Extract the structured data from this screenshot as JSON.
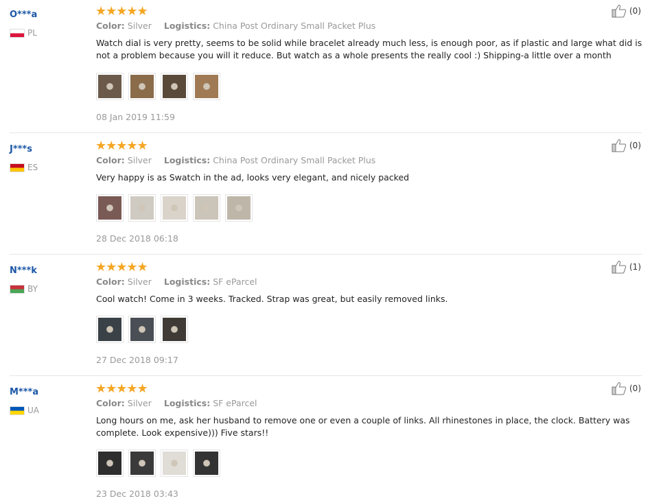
{
  "reviews": [
    {
      "user": "O***a",
      "country": "PL",
      "flag": [
        "#ffffff",
        "#dc143c"
      ],
      "rating": 5,
      "stars": "★★★★★",
      "color_label": "Color:",
      "color_value": "Silver",
      "logistics_label": "Logistics:",
      "logistics_value": "China Post Ordinary Small Packet Plus",
      "text": "Watch dial is very pretty, seems to be solid while bracelet already much less, is enough poor, as if plastic and large what did is not a problem because you will it reduce. But watch as a whole presents the really cool :) Shipping-a little over a month",
      "likes": "(0)",
      "date": "08 Jan 2019 11:59",
      "photos": [
        "#6b5a4a",
        "#8a6b4a",
        "#5a4a3a",
        "#a07a55"
      ]
    },
    {
      "user": "J***s",
      "country": "ES",
      "flag": [
        "#c60b1e",
        "#ffc400"
      ],
      "rating": 5,
      "stars": "★★★★★",
      "color_label": "Color:",
      "color_value": "Silver",
      "logistics_label": "Logistics:",
      "logistics_value": "China Post Ordinary Small Packet Plus",
      "text": "Very happy is as Swatch in the ad, looks very elegant, and nicely packed",
      "likes": "(0)",
      "date": "28 Dec 2018 06:18",
      "photos": [
        "#7a5a55",
        "#cfcac2",
        "#d9d3ca",
        "#cbc4b8",
        "#bfb6aa"
      ]
    },
    {
      "user": "N***k",
      "country": "BY",
      "flag": [
        "#c8313e",
        "#4aa657"
      ],
      "rating": 5,
      "stars": "★★★★★",
      "color_label": "Color:",
      "color_value": "Silver",
      "logistics_label": "Logistics:",
      "logistics_value": "SF eParcel",
      "text": "Cool watch! Come in 3 weeks. Tracked. Strap was great, but easily removed links.",
      "likes": "(1)",
      "date": "27 Dec 2018 09:17",
      "photos": [
        "#3a4248",
        "#4a4f55",
        "#3f3a35"
      ]
    },
    {
      "user": "M***a",
      "country": "UA",
      "flag": [
        "#0057b7",
        "#ffd700"
      ],
      "rating": 5,
      "stars": "★★★★★",
      "color_label": "Color:",
      "color_value": "Silver",
      "logistics_label": "Logistics:",
      "logistics_value": "SF eParcel",
      "text": "Long hours on me, ask her husband to remove one or even a couple of links. All rhinestones in place, the clock. Battery was complete. Look expensive))) Five stars!!",
      "likes": "(0)",
      "date": "23 Dec 2018 03:43",
      "photos": [
        "#2e2e2e",
        "#3a3a3a",
        "#e0dcd6",
        "#333333"
      ]
    }
  ],
  "colors": {
    "username": "#1c57a6",
    "stars": "#f5a623",
    "muted": "#999999"
  }
}
